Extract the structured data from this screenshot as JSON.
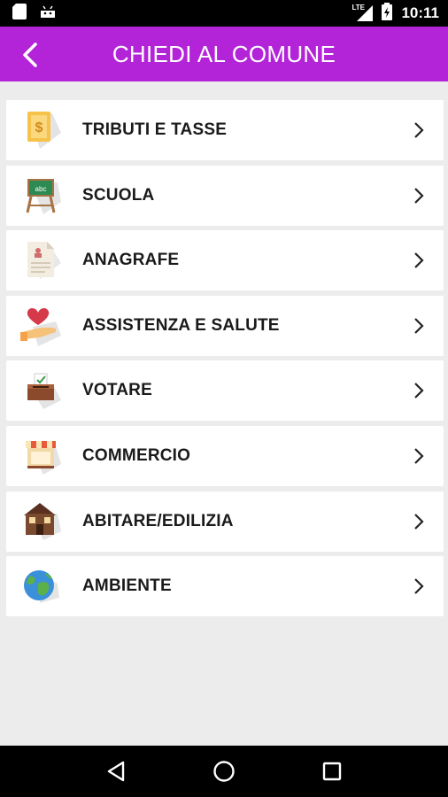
{
  "status_bar": {
    "time": "10:11",
    "network": "LTE"
  },
  "app_bar": {
    "title": "CHIEDI AL COMUNE",
    "back_icon": "arrow-left-icon",
    "background": "#b324d9"
  },
  "menu": {
    "items": [
      {
        "label": "TRIBUTI E TASSE",
        "icon": "tax-document-icon"
      },
      {
        "label": "SCUOLA",
        "icon": "school-blackboard-icon"
      },
      {
        "label": "ANAGRAFE",
        "icon": "registry-document-icon"
      },
      {
        "label": "ASSISTENZA E SALUTE",
        "icon": "heart-hand-icon"
      },
      {
        "label": "VOTARE",
        "icon": "ballot-box-icon"
      },
      {
        "label": "COMMERCIO",
        "icon": "shop-icon"
      },
      {
        "label": "ABITARE/EDILIZIA",
        "icon": "house-icon"
      },
      {
        "label": "AMBIENTE",
        "icon": "globe-icon"
      }
    ]
  }
}
